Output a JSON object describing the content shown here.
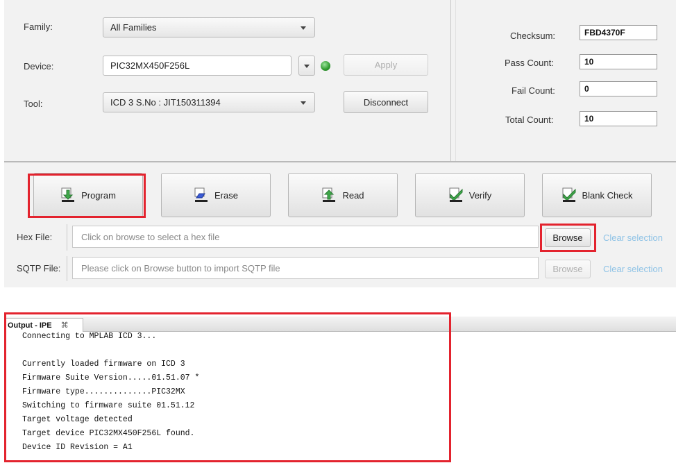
{
  "device_panel": {
    "family_label": "Family:",
    "family_value": "All Families",
    "device_label": "Device:",
    "device_value": "PIC32MX450F256L",
    "apply_label": "Apply",
    "tool_label": "Tool:",
    "tool_value": "ICD 3 S.No : JIT150311394",
    "disconnect_label": "Disconnect"
  },
  "stats": {
    "checksum_label": "Checksum:",
    "checksum_value": "FBD4370F",
    "pass_label": "Pass Count:",
    "pass_value": "10",
    "fail_label": "Fail Count:",
    "fail_value": "0",
    "total_label": "Total Count:",
    "total_value": "10"
  },
  "actions": {
    "program": "Program",
    "erase": "Erase",
    "read": "Read",
    "verify": "Verify",
    "blank_check": "Blank Check"
  },
  "hex_row": {
    "label": "Hex File:",
    "placeholder": "Click on browse to select a hex file",
    "browse": "Browse",
    "clear": "Clear selection"
  },
  "sqtp_row": {
    "label": "SQTP File:",
    "placeholder": "Please click on Browse button to import SQTP file",
    "browse": "Browse",
    "clear": "Clear selection"
  },
  "output": {
    "tab_label": "Output - IPE",
    "tab_close": "⌘",
    "lines": [
      "Connecting to MPLAB ICD 3...",
      "",
      "Currently loaded firmware on ICD 3",
      "Firmware Suite Version.....01.51.07 *",
      "Firmware type..............PIC32MX",
      "Switching to firmware suite 01.51.12",
      "Target voltage detected",
      "Target device PIC32MX450F256L found.",
      "Device ID Revision = A1"
    ]
  },
  "colors": {
    "highlight": "#e3232e",
    "status_led": "#2e9a2e",
    "link": "#8fc3e6"
  }
}
